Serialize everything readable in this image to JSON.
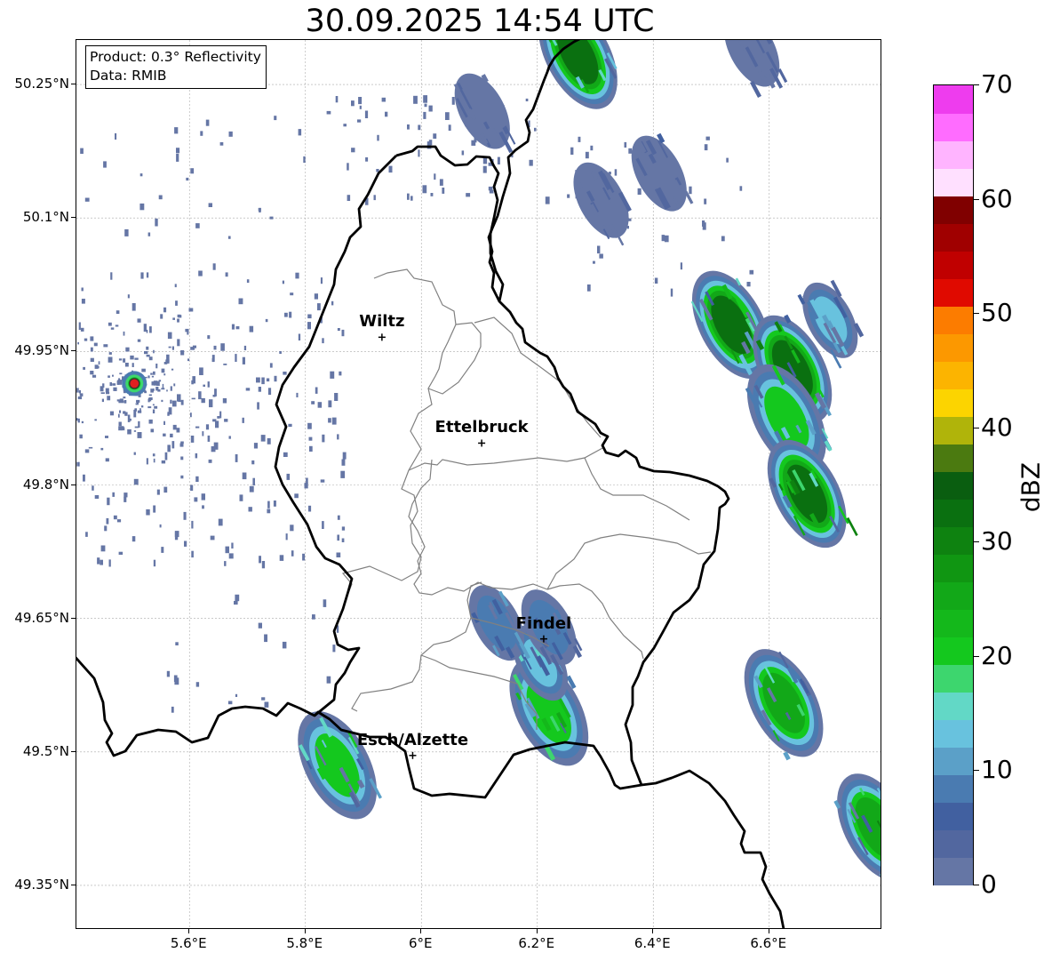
{
  "title": "30.09.2025 14:54 UTC",
  "info": {
    "product": "Product: 0.3° Reflectivity",
    "data": "Data: RMIB"
  },
  "lat_labels": [
    "50.25°N",
    "50.1°N",
    "49.95°N",
    "49.8°N",
    "49.65°N",
    "49.5°N",
    "49.35°N"
  ],
  "lon_labels": [
    "5.6°E",
    "5.8°E",
    "6°E",
    "6.2°E",
    "6.4°E",
    "6.6°E"
  ],
  "cities": [
    {
      "id": "wiltz",
      "name": "Wiltz",
      "lon": 5.932,
      "lat": 49.966
    },
    {
      "id": "ettelbruck",
      "name": "Ettelbruck",
      "lon": 6.104,
      "lat": 49.847
    },
    {
      "id": "findel",
      "name": "Findel",
      "lon": 6.211,
      "lat": 49.627
    },
    {
      "id": "esch",
      "name": "Esch/Alzette",
      "lon": 5.985,
      "lat": 49.496
    }
  ],
  "radar_site": {
    "lon": 5.505,
    "lat": 49.914
  },
  "map_extent": {
    "lon_min": 5.405,
    "lon_max": 6.795,
    "lat_min": 49.3,
    "lat_max": 50.3
  },
  "colorbar": {
    "label": "dBZ",
    "min": 0,
    "max": 70,
    "tick_labels": [
      "0",
      "10",
      "20",
      "30",
      "40",
      "50",
      "60",
      "70"
    ],
    "colors": [
      "#6576a5",
      "#52679f",
      "#4160a0",
      "#4a7bb1",
      "#5ba0c8",
      "#68c2de",
      "#62d8c6",
      "#3dd66e",
      "#14c81e",
      "#14b81b",
      "#12a818",
      "#109612",
      "#0e8210",
      "#0a7010",
      "#0a5e10",
      "#4b7a10",
      "#b0b40a",
      "#fcd400",
      "#fcb400",
      "#fc9800",
      "#fc7c00",
      "#e00a00",
      "#c00000",
      "#a00000",
      "#800000",
      "#ffe0ff",
      "#ffb4ff",
      "#ff6cff",
      "#ee3cee"
    ]
  },
  "echo_cells": [
    {
      "lon": 6.27,
      "lat": 50.283,
      "dbz": 34
    },
    {
      "lon": 6.535,
      "lat": 49.98,
      "dbz": 32
    },
    {
      "lon": 6.64,
      "lat": 49.93,
      "dbz": 33
    },
    {
      "lon": 6.63,
      "lat": 49.875,
      "dbz": 24
    },
    {
      "lon": 6.705,
      "lat": 49.985,
      "dbz": 15
    },
    {
      "lon": 6.665,
      "lat": 49.79,
      "dbz": 32
    },
    {
      "lon": 6.625,
      "lat": 49.555,
      "dbz": 30
    },
    {
      "lon": 6.785,
      "lat": 49.415,
      "dbz": 30
    },
    {
      "lon": 6.22,
      "lat": 49.545,
      "dbz": 25
    },
    {
      "lon": 6.205,
      "lat": 49.6,
      "dbz": 16
    },
    {
      "lon": 6.13,
      "lat": 49.645,
      "dbz": 12
    },
    {
      "lon": 6.22,
      "lat": 49.64,
      "dbz": 10
    },
    {
      "lon": 5.855,
      "lat": 49.485,
      "dbz": 22
    },
    {
      "lon": 6.105,
      "lat": 50.22,
      "dbz": 5
    },
    {
      "lon": 6.41,
      "lat": 50.15,
      "dbz": 5
    },
    {
      "lon": 6.31,
      "lat": 50.12,
      "dbz": 5
    },
    {
      "lon": 6.57,
      "lat": 50.29,
      "dbz": 5
    }
  ]
}
